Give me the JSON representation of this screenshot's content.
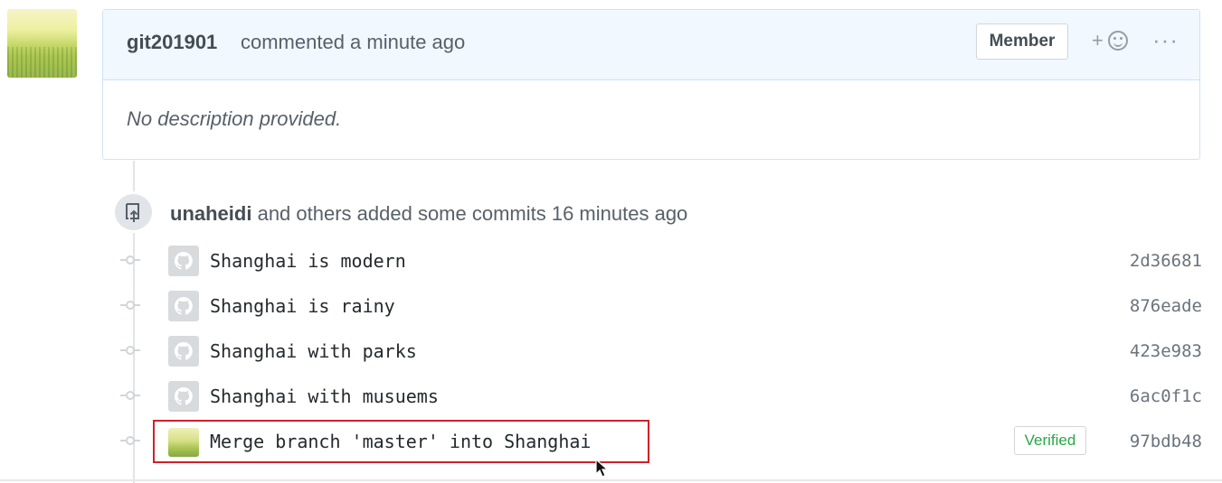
{
  "comment": {
    "author": "git201901",
    "meta": "commented a minute ago",
    "badge": "Member",
    "reaction_plus": "+",
    "more": "···",
    "body": "No description provided."
  },
  "event": {
    "actor": "unaheidi",
    "text": "and others added some commits 16 minutes ago"
  },
  "commits": [
    {
      "message": "Shanghai is modern",
      "sha": "2d36681"
    },
    {
      "message": "Shanghai is rainy",
      "sha": "876eade"
    },
    {
      "message": "Shanghai with parks",
      "sha": "423e983"
    },
    {
      "message": "Shanghai with musuems",
      "sha": "6ac0f1c"
    },
    {
      "message": "Merge branch 'master' into Shanghai",
      "sha": "97bdb48",
      "verified": "Verified"
    }
  ],
  "colors": {
    "header_bg": "#f1f8ff",
    "verified": "#28a745",
    "highlight": "#d0202a"
  }
}
